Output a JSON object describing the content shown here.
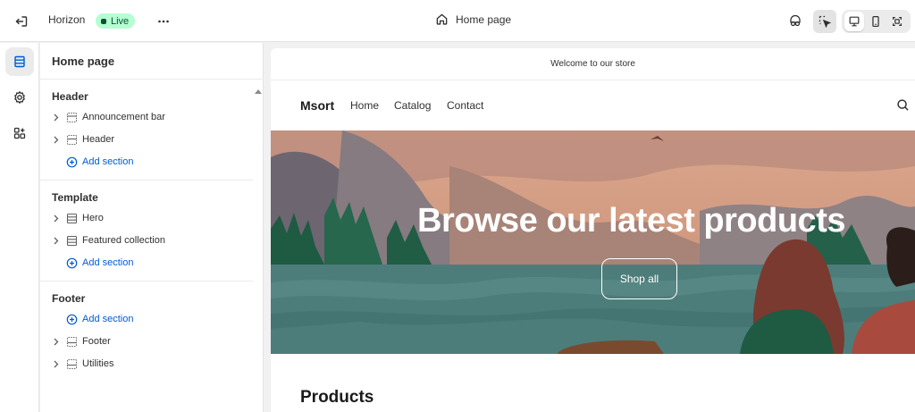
{
  "topbar": {
    "theme_name": "Horizon",
    "live_label": "Live",
    "page_label": "Home page"
  },
  "panel": {
    "title": "Home page",
    "groups": [
      {
        "title": "Header",
        "items": [
          "Announcement bar",
          "Header"
        ],
        "add_label": "Add section"
      },
      {
        "title": "Template",
        "items": [
          "Hero",
          "Featured collection"
        ],
        "add_label": "Add section"
      },
      {
        "title": "Footer",
        "add_label": "Add section",
        "items": [
          "Footer",
          "Utilities"
        ]
      }
    ]
  },
  "preview": {
    "announcement": "Welcome to our store",
    "logo": "Msort",
    "nav": [
      "Home",
      "Catalog",
      "Contact"
    ],
    "hero_heading": "Browse our latest products",
    "hero_button": "Shop all",
    "products_title": "Products"
  },
  "colors": {
    "accent_blue": "#005bd3",
    "live_badge_bg": "#b4fed2",
    "live_badge_text": "#0c5132"
  },
  "icons": {
    "exit": "exit-icon",
    "more": "more-horizontal-icon",
    "page": "home-icon",
    "inspect": "inspector-icon",
    "select": "select-element-icon",
    "desktop": "desktop-icon",
    "mobile": "mobile-icon",
    "fullscreen": "fullscreen-icon",
    "sections": "sections-icon",
    "settings": "gear-icon",
    "apps": "apps-icon",
    "search": "search-icon"
  }
}
